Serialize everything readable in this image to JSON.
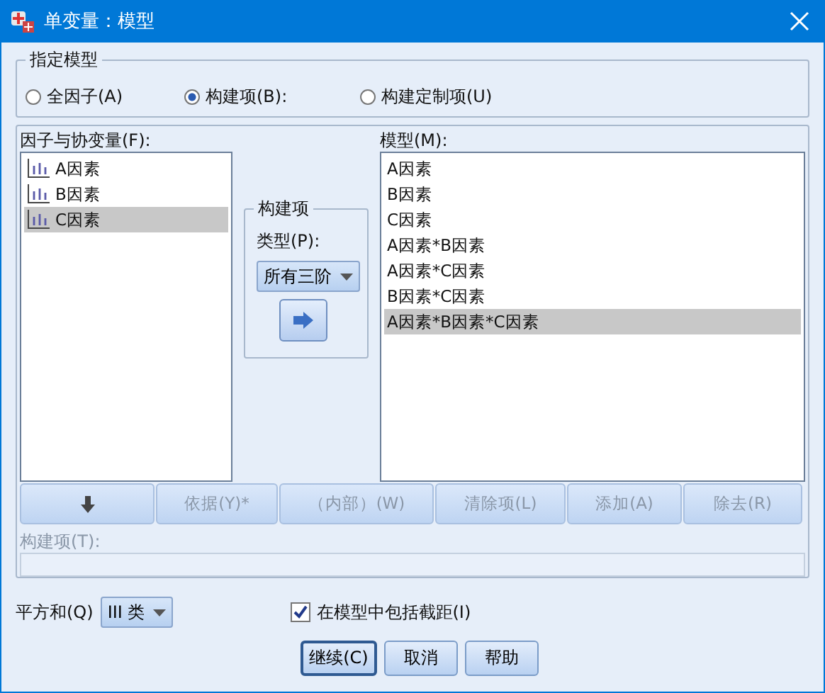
{
  "window": {
    "title": "单变量：模型"
  },
  "model_spec": {
    "legend": "指定模型",
    "radios": [
      {
        "label": "全因子(A)",
        "selected": false
      },
      {
        "label": "构建项(B):",
        "selected": true
      },
      {
        "label": "构建定制项(U)",
        "selected": false
      }
    ]
  },
  "factors": {
    "label": "因子与协变量(F):",
    "items": [
      {
        "label": "A因素",
        "selected": false
      },
      {
        "label": "B因素",
        "selected": false
      },
      {
        "label": "C因素",
        "selected": true
      }
    ]
  },
  "build": {
    "legend": "构建项",
    "type_label": "类型(P):",
    "type_value": "所有三阶"
  },
  "model": {
    "label": "模型(M):",
    "items": [
      {
        "label": "A因素",
        "selected": false
      },
      {
        "label": "B因素",
        "selected": false
      },
      {
        "label": "C因素",
        "selected": false
      },
      {
        "label": "A因素*B因素",
        "selected": false
      },
      {
        "label": "A因素*C因素",
        "selected": false
      },
      {
        "label": "B因素*C因素",
        "selected": false
      },
      {
        "label": "A因素*B因素*C因素",
        "selected": true
      }
    ]
  },
  "action_buttons": [
    {
      "kind": "icon",
      "disabled": false
    },
    {
      "kind": "text",
      "label": "依据(Y)*",
      "disabled": true
    },
    {
      "kind": "text",
      "label": "（内部）(W)",
      "disabled": true
    },
    {
      "kind": "text",
      "label": "清除项(L)",
      "disabled": true
    },
    {
      "kind": "text",
      "label": "添加(A)",
      "disabled": true
    },
    {
      "kind": "text",
      "label": "除去(R)",
      "disabled": true
    }
  ],
  "terms_field": {
    "label": "构建项(T):"
  },
  "sum_of_squares": {
    "label": "平方和(Q)",
    "value": "III 类"
  },
  "intercept": {
    "label": "在模型中包括截距(I)",
    "checked": true
  },
  "footer_buttons": [
    {
      "label": "继续(C)",
      "default": true
    },
    {
      "label": "取消",
      "default": false
    },
    {
      "label": "帮助",
      "default": false
    }
  ]
}
